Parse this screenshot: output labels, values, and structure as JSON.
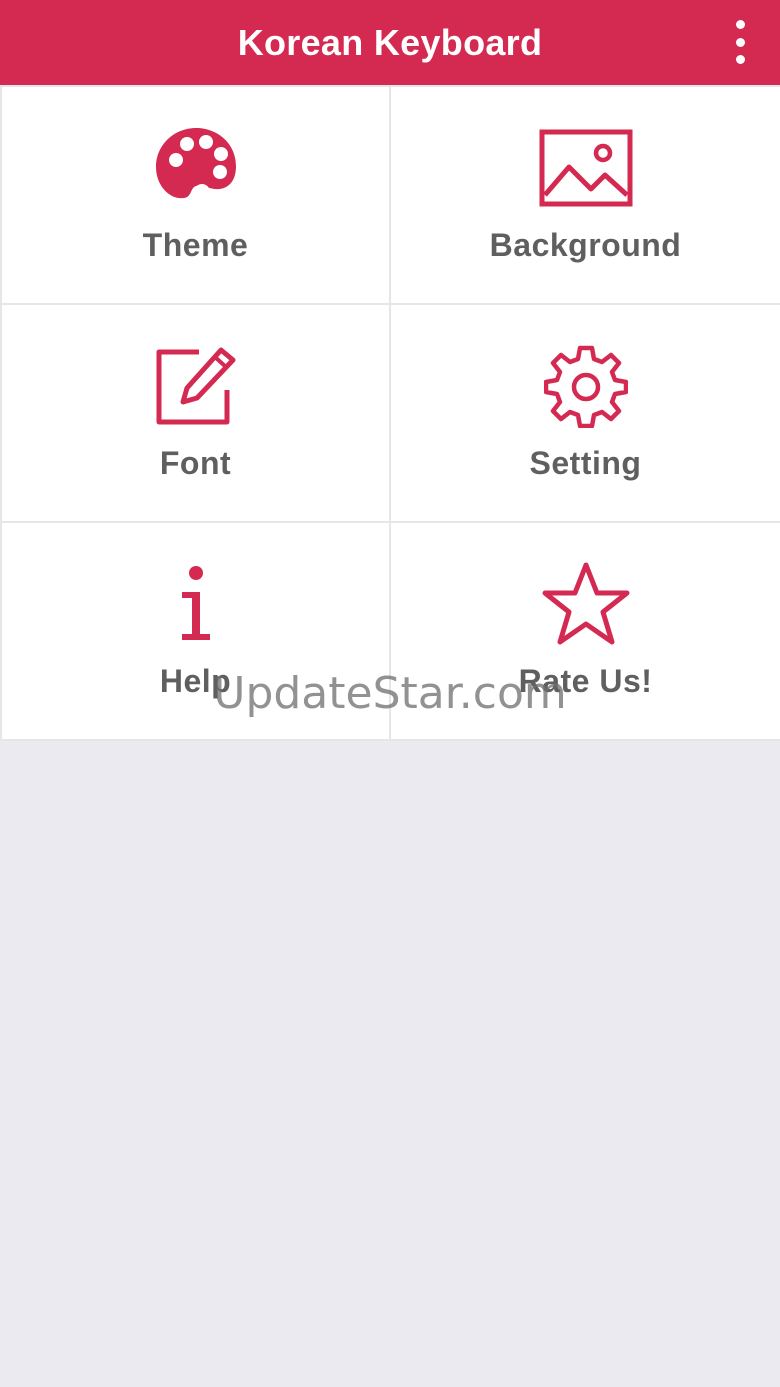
{
  "app_bar": {
    "title": "Korean Keyboard",
    "overflow_icon": "more-vert-icon",
    "background_color": "#d42a51"
  },
  "menu": {
    "items": [
      {
        "label": "Theme",
        "icon": "palette-icon"
      },
      {
        "label": "Background",
        "icon": "image-icon"
      },
      {
        "label": "Font",
        "icon": "edit-icon"
      },
      {
        "label": "Setting",
        "icon": "gear-icon"
      },
      {
        "label": "Help",
        "icon": "info-icon"
      },
      {
        "label": "Rate Us!",
        "icon": "star-icon"
      }
    ],
    "accent_color": "#d42a51",
    "label_color": "#5f5f5f"
  },
  "watermark": {
    "text": "UpdateStar.com"
  }
}
